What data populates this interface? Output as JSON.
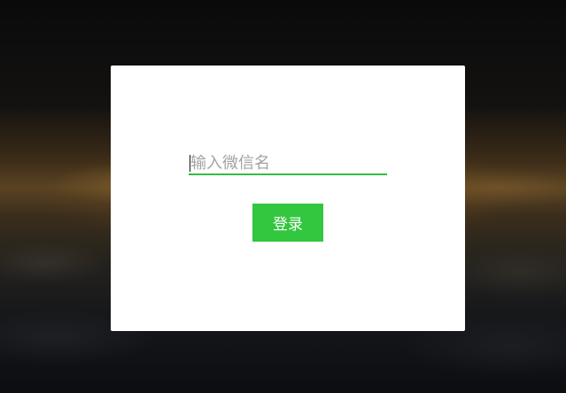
{
  "login": {
    "name_placeholder": "输入微信名",
    "name_value": "",
    "button_label": "登录"
  },
  "colors": {
    "accent": "#33c63f",
    "input_underline": "#2fbf44",
    "dialog_background": "#ffffff"
  }
}
